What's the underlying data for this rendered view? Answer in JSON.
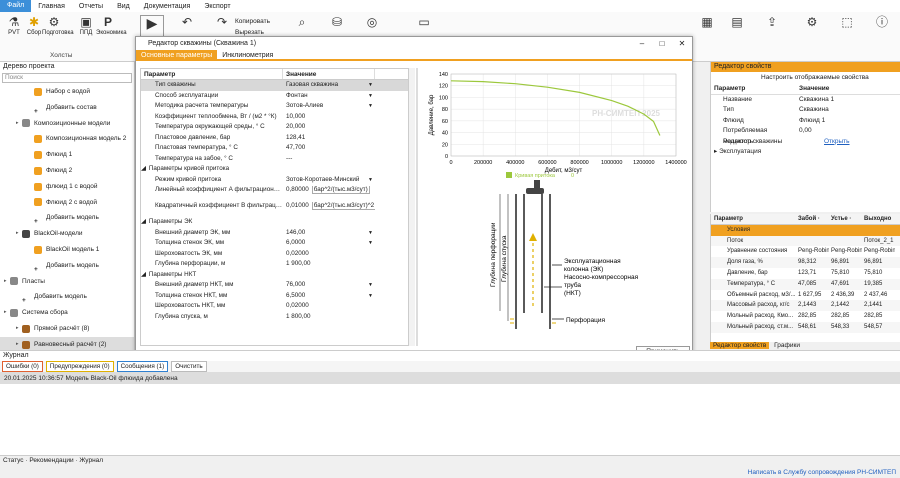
{
  "menu": {
    "items": [
      "Файл",
      "Главная",
      "Отчеты",
      "Вид",
      "Документация",
      "Экспорт"
    ]
  },
  "ribbon": {
    "buttons": [
      "PVT",
      "Сбор",
      "Подготовка",
      "ППД",
      "Экономика"
    ],
    "group_label": "Холсты",
    "copy": "Копировать",
    "cut": "Вырезать"
  },
  "tree": {
    "title": "Дерево проекта",
    "search": "Поиск",
    "items": [
      {
        "label": "Набор с водой",
        "level": 2,
        "color": "#f0a020"
      },
      {
        "label": "Добавить состав",
        "level": 2,
        "color": "plus"
      },
      {
        "label": "Композиционные модели",
        "level": 1,
        "color": "#888"
      },
      {
        "label": "Композиционная модель 2",
        "level": 2,
        "color": "#f0a020"
      },
      {
        "label": "Флюид 1",
        "level": 2,
        "color": "#f0a020"
      },
      {
        "label": "Флюид 2",
        "level": 2,
        "color": "#f0a020"
      },
      {
        "label": "флюид 1 с водой",
        "level": 2,
        "color": "#f0a020"
      },
      {
        "label": "Флюид 2 с водой",
        "level": 2,
        "color": "#f0a020"
      },
      {
        "label": "Добавить модель",
        "level": 2,
        "color": "plus"
      },
      {
        "label": "BlackOil-модели",
        "level": 1,
        "color": "#444"
      },
      {
        "label": "BlackOil модель 1",
        "level": 2,
        "color": "#f0a020"
      },
      {
        "label": "Добавить модель",
        "level": 2,
        "color": "plus"
      },
      {
        "label": "Пласты",
        "level": 0,
        "color": "#888"
      },
      {
        "label": "Добавить модель",
        "level": 1,
        "color": "plus"
      },
      {
        "label": "Система сбора",
        "level": 0,
        "color": "#888"
      },
      {
        "label": "Прямой расчёт (8)",
        "level": 1,
        "color": "#a06020"
      },
      {
        "label": "Равновесный расчёт (2)",
        "level": 1,
        "color": "#a06020"
      }
    ]
  },
  "dialog": {
    "title": "Редактор скважины (Скважина 1)",
    "tabs": [
      "Основные параметры",
      "Инклинометрия"
    ],
    "ok": "Применить",
    "col_param": "Параметр",
    "col_value": "Значение",
    "rows": [
      {
        "n": "Тип скважины",
        "v": "Газовая скважина",
        "sel": true,
        "drop": true
      },
      {
        "n": "Способ эксплуатации",
        "v": "Фонтан",
        "drop": true
      },
      {
        "n": "Методика расчета температуры",
        "v": "Зотов-Алиев",
        "drop": true
      },
      {
        "n": "Коэффициент теплообмена, Вт / (м2 * °К)",
        "v": "10,000"
      },
      {
        "n": "Температура окружающей среды, ° С",
        "v": "20,000"
      },
      {
        "n": "Пластовое давление, бар",
        "v": "128,41"
      },
      {
        "n": "Пластовая температура, ° С",
        "v": "47,700"
      },
      {
        "n": "Температура на забое, ° С",
        "v": "---"
      },
      {
        "n": "Параметры кривой притока",
        "v": "",
        "sec": true
      },
      {
        "n": "Режим кривой притока",
        "v": "Зотов-Коротаев-Минский",
        "drop": true
      },
      {
        "n": "Линейный коэффициент А фильтрационного сопротивления",
        "v": "0,80000",
        "u": "бар^2/(тыс.м3/сут)",
        "tall": true
      },
      {
        "n": "Квадратичный коэффициент В фильтрационного сопротивления",
        "v": "0,01000",
        "u": "бар^2/(тыс.м3/сут)^2",
        "tall": true
      },
      {
        "n": "Параметры ЭК",
        "v": "",
        "sec": true
      },
      {
        "n": "Внешний диаметр ЭК, мм",
        "v": "146,00",
        "drop": true
      },
      {
        "n": "Толщина стенок ЭК, мм",
        "v": "6,0000",
        "drop": true
      },
      {
        "n": "Шероховатость ЭК, мм",
        "v": "0,02000"
      },
      {
        "n": "Глубина перфорации, м",
        "v": "1 900,00"
      },
      {
        "n": "Параметры НКТ",
        "v": "",
        "sec": true
      },
      {
        "n": "Внешний диаметр НКТ, мм",
        "v": "76,000",
        "drop": true
      },
      {
        "n": "Толщина стенок НКТ, мм",
        "v": "6,5000",
        "drop": true
      },
      {
        "n": "Шероховатость НКТ, мм",
        "v": "0,02000"
      },
      {
        "n": "Глубина спуска, м",
        "v": "1 800,00"
      }
    ]
  },
  "chart_data": {
    "type": "line",
    "title": "",
    "xlabel": "Дебит, м3/сут",
    "ylabel": "Давление, бар",
    "xlim": [
      0,
      1400000
    ],
    "ylim": [
      0,
      140
    ],
    "xticks": [
      "0",
      "200000",
      "400000",
      "600000",
      "800000",
      "1000000",
      "1200000",
      "1400000"
    ],
    "yticks": [
      "0",
      "20",
      "40",
      "60",
      "80",
      "100",
      "120",
      "140"
    ],
    "series": [
      {
        "name": "Кривая притока",
        "color": "#9cc83c",
        "x": [
          0,
          200000,
          400000,
          600000,
          800000,
          1000000,
          1100000,
          1200000,
          1260000,
          1300000
        ],
        "y": [
          128.4,
          127,
          123.5,
          117.5,
          108.5,
          94.5,
          85,
          71.5,
          59,
          35
        ]
      }
    ],
    "legend_value": "0",
    "watermark": "РН-СИМТЕП 2025"
  },
  "diagram": {
    "ek": "Эксплуатационная колонна (ЭК)",
    "nkt": "Насосно-компрессорная труба (НКТ)",
    "perf": "Перфорация",
    "depth_perf": "Глубина перфорации",
    "depth_spusk": "Глубина спуска"
  },
  "props": {
    "title": "Редактор свойств",
    "configure": "Настроить отображаемые свойства",
    "col_param": "Параметр",
    "col_value": "Значение",
    "rows": [
      {
        "k": "Название",
        "v": "Скважина 1"
      },
      {
        "k": "Тип",
        "v": "Скважина"
      },
      {
        "k": "Флюид",
        "v": "Флюид 1"
      },
      {
        "k": "Потребляемая мощность",
        "v": "0,00"
      },
      {
        "k": "Редактор скважины",
        "v": "Открыть"
      },
      {
        "k": "Эксплуатация",
        "v": ""
      }
    ]
  },
  "grid": {
    "headers": [
      "Параметр",
      "Забой ·",
      "Устье ·",
      "Выходно"
    ],
    "section": "Условия",
    "rows": [
      [
        "Поток",
        "",
        "",
        "Поток_2_1"
      ],
      [
        "Уравнение состояния",
        "Peng-Robin",
        "Peng-Robin",
        "Peng-Robin"
      ],
      [
        "Доля газа, %",
        "98,312",
        "96,891",
        "96,891"
      ],
      [
        "Давление, бар",
        "123,71",
        "75,810",
        "75,810"
      ],
      [
        "Температура, ° С",
        "47,085",
        "47,691",
        "19,385"
      ],
      [
        "Объемный расход, м3/...",
        "1 627,95",
        "2 436,39",
        "2 437,46"
      ],
      [
        "Массовый расход, кг/с",
        "2,1443",
        "2,1442",
        "2,1441"
      ],
      [
        "Мольный расход, Кмо...",
        "282,85",
        "282,85",
        "282,85"
      ],
      [
        "Мольный расход, ст.м...",
        "548,61",
        "548,33",
        "548,57"
      ]
    ],
    "tabs": [
      "Редактор свойств",
      "Графики"
    ]
  },
  "journal": {
    "title": "Журнал",
    "buttons": [
      "Ошибки (0)",
      "Предупреждения (0)",
      "Сообщения (1)",
      "Очистить"
    ],
    "entry": "20.01.2025 10:36:57   Модель Black-Oil флюида добавлена"
  },
  "status": {
    "tabs": "Статус · Рекомендации · Журнал",
    "help": "Написать в Службу сопровождения РН-СИМТЕП"
  }
}
